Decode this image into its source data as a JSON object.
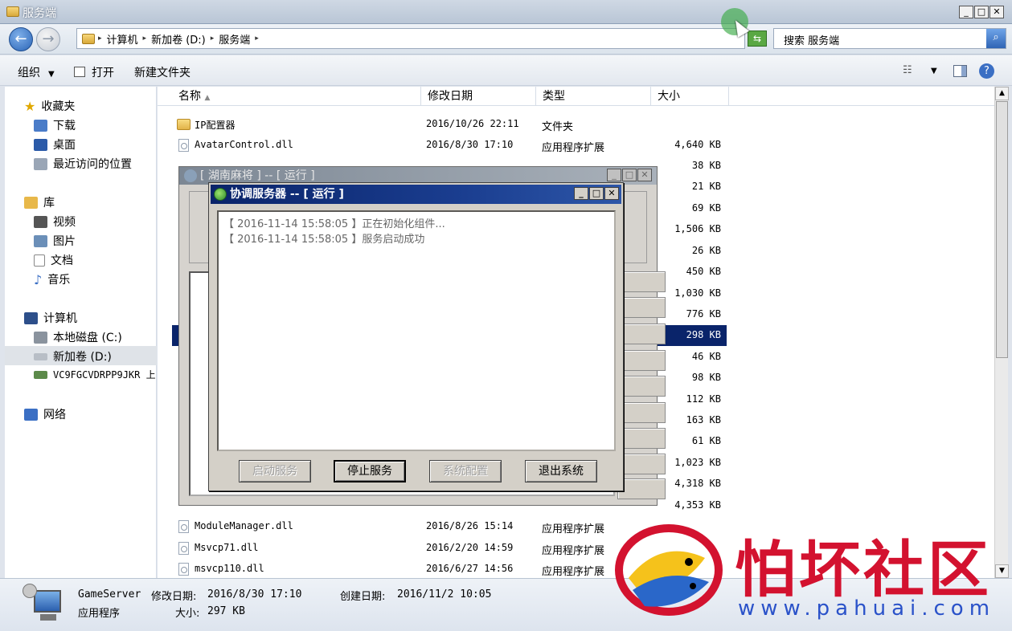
{
  "window": {
    "title": "服务端",
    "controls": [
      "_",
      "□",
      "✕"
    ]
  },
  "address": {
    "crumbs": [
      "计算机",
      "新加卷 (D:)",
      "服务端"
    ],
    "search_placeholder": "搜索 服务端"
  },
  "toolbar": {
    "organize": "组织",
    "open": "打开",
    "new_folder": "新建文件夹"
  },
  "nav": {
    "favorites": "收藏夹",
    "downloads": "下载",
    "desktop": "桌面",
    "recent": "最近访问的位置",
    "libraries": "库",
    "videos": "视频",
    "pictures": "图片",
    "documents": "文档",
    "music": "音乐",
    "computer": "计算机",
    "drive_c": "本地磁盘 (C:)",
    "drive_d": "新加卷 (D:)",
    "network_drive": "VC9FGCVDRPP9JKR 上",
    "network": "网络"
  },
  "columns": {
    "name": "名称",
    "date": "修改日期",
    "type": "类型",
    "size": "大小"
  },
  "files": [
    {
      "name": "IP配置器",
      "date": "2016/10/26 22:11",
      "type": "文件夹",
      "size": ""
    },
    {
      "name": "AvatarControl.dll",
      "date": "2016/8/30 17:10",
      "type": "应用程序扩展",
      "size": "4,640 KB"
    }
  ],
  "sizes_visible": [
    "38 KB",
    "21 KB",
    "69 KB",
    "1,506 KB",
    "26 KB",
    "450 KB",
    "1,030 KB",
    "776 KB",
    "298 KB",
    "46 KB",
    "98 KB",
    "112 KB",
    "163 KB",
    "61 KB",
    "1,023 KB",
    "4,318 KB",
    "4,353 KB"
  ],
  "files_bottom": [
    {
      "name": "ModuleManager.dll",
      "date": "2016/8/26 15:14",
      "type": "应用程序扩展"
    },
    {
      "name": "Msvcp71.dll",
      "date": "2016/2/20 14:59",
      "type": "应用程序扩展"
    },
    {
      "name": "msvcp110.dll",
      "date": "2016/6/27 14:56",
      "type": "应用程序扩展"
    }
  ],
  "details": {
    "name": "GameServer",
    "modified_label": "修改日期:",
    "modified": "2016/8/30 17:10",
    "created_label": "创建日期:",
    "created": "2016/11/2 10:05",
    "kind": "应用程序",
    "size_label": "大小:",
    "size": "297 KB"
  },
  "bg_window": {
    "title": "[ 湖南麻将 ] -- [ 运行 ]"
  },
  "dialog": {
    "title": "协调服务器 -- [ 运行 ]",
    "log": [
      "【 2016-11-14 15:58:05 】正在初始化组件...",
      "【 2016-11-14 15:58:05 】服务启动成功"
    ],
    "buttons": {
      "start": "启动服务",
      "stop": "停止服务",
      "config": "系统配置",
      "exit": "退出系统"
    }
  },
  "watermark": {
    "text": "怕坏社区",
    "url": "www.pahuai.com"
  }
}
